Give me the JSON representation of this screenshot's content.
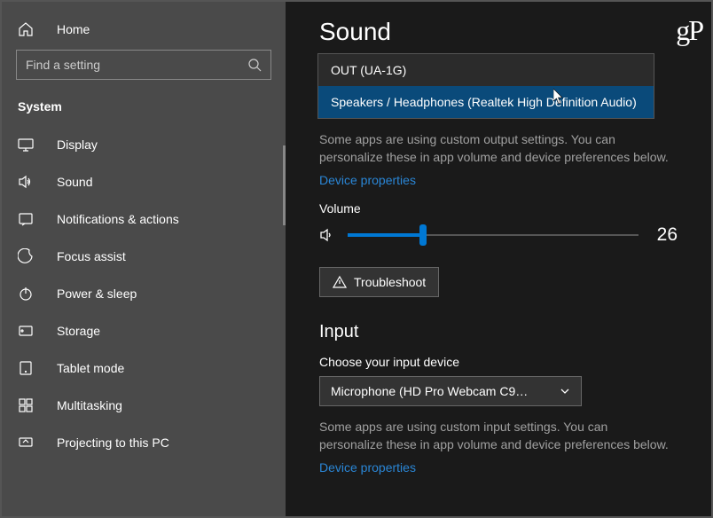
{
  "sidebar": {
    "home": "Home",
    "search_placeholder": "Find a setting",
    "section": "System",
    "items": [
      {
        "label": "Display"
      },
      {
        "label": "Sound"
      },
      {
        "label": "Notifications & actions"
      },
      {
        "label": "Focus assist"
      },
      {
        "label": "Power & sleep"
      },
      {
        "label": "Storage"
      },
      {
        "label": "Tablet mode"
      },
      {
        "label": "Multitasking"
      },
      {
        "label": "Projecting to this PC"
      }
    ]
  },
  "main": {
    "title": "Sound",
    "output_dropdown": {
      "option0": "OUT (UA-1G)",
      "option1": "Speakers / Headphones (Realtek High Definition Audio)"
    },
    "output_hint": "Some apps are using custom output settings. You can personalize these in app volume and device preferences below.",
    "device_properties": "Device properties",
    "volume_label": "Volume",
    "volume_value": "26",
    "troubleshoot": "Troubleshoot",
    "input_title": "Input",
    "input_label": "Choose your input device",
    "input_selected": "Microphone (HD Pro Webcam C9…",
    "input_hint": "Some apps are using custom input settings. You can personalize these in app volume and device preferences below."
  },
  "watermark": "gP"
}
